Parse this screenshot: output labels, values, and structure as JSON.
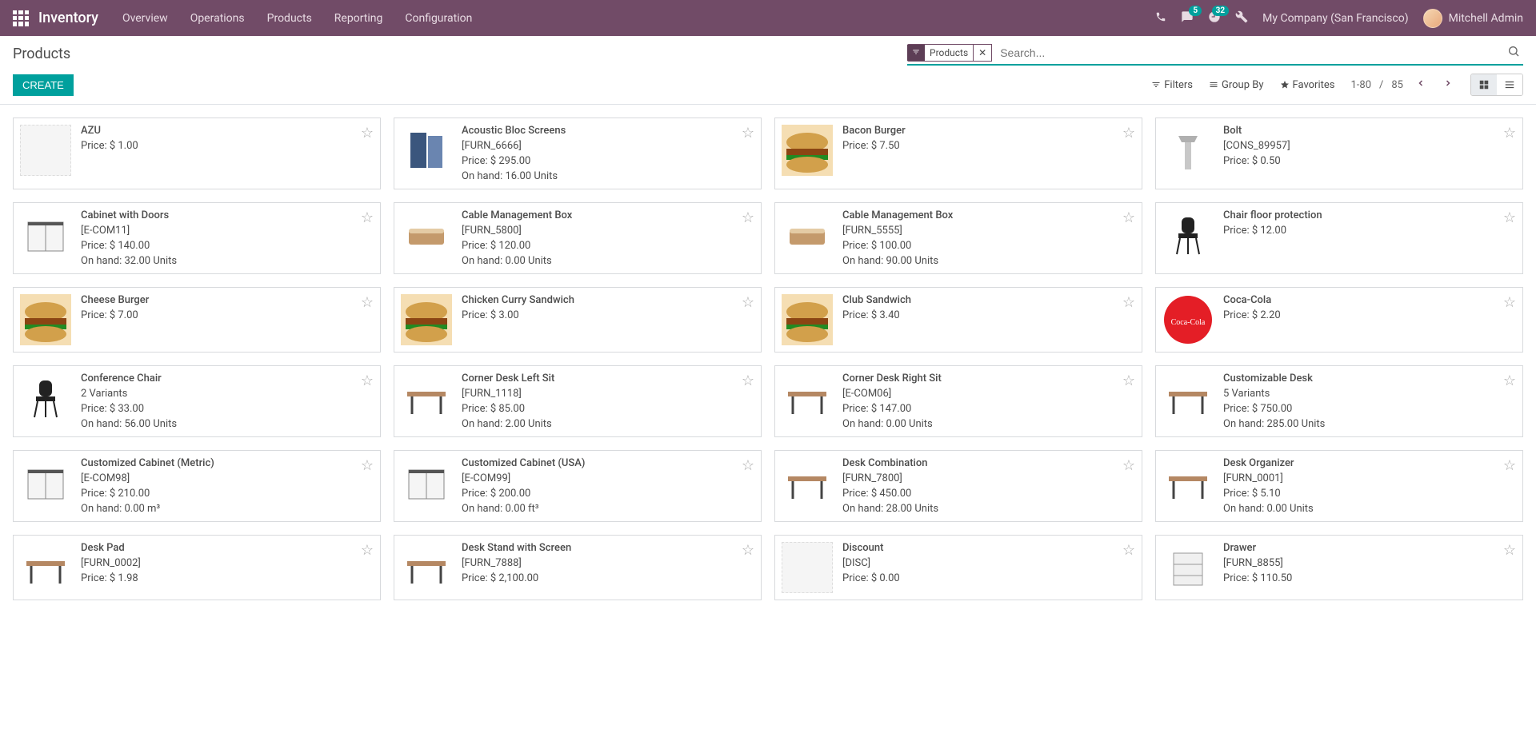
{
  "nav": {
    "appTitle": "Inventory",
    "menu": [
      "Overview",
      "Operations",
      "Products",
      "Reporting",
      "Configuration"
    ],
    "badges": {
      "messages": "5",
      "activities": "32"
    },
    "company": "My Company (San Francisco)",
    "user": "Mitchell Admin"
  },
  "control": {
    "breadcrumb": "Products",
    "createLabel": "CREATE",
    "filterTag": "Products",
    "searchPlaceholder": "Search...",
    "tools": {
      "filters": "Filters",
      "groupBy": "Group By",
      "favorites": "Favorites"
    },
    "pager": {
      "range": "1-80",
      "sep": "/",
      "total": "85"
    }
  },
  "products": [
    {
      "name": "AZU",
      "price": "Price: $ 1.00"
    },
    {
      "name": "Acoustic Bloc Screens",
      "sku": "[FURN_6666]",
      "price": "Price: $ 295.00",
      "onhand": "On hand: 16.00 Units"
    },
    {
      "name": "Bacon Burger",
      "price": "Price: $ 7.50"
    },
    {
      "name": "Bolt",
      "sku": "[CONS_89957]",
      "price": "Price: $ 0.50"
    },
    {
      "name": "Cabinet with Doors",
      "sku": "[E-COM11]",
      "price": "Price: $ 140.00",
      "onhand": "On hand: 32.00 Units"
    },
    {
      "name": "Cable Management Box",
      "sku": "[FURN_5800]",
      "price": "Price: $ 120.00",
      "onhand": "On hand: 0.00 Units"
    },
    {
      "name": "Cable Management Box",
      "sku": "[FURN_5555]",
      "price": "Price: $ 100.00",
      "onhand": "On hand: 90.00 Units"
    },
    {
      "name": "Chair floor protection",
      "price": "Price: $ 12.00"
    },
    {
      "name": "Cheese Burger",
      "price": "Price: $ 7.00"
    },
    {
      "name": "Chicken Curry Sandwich",
      "price": "Price: $ 3.00"
    },
    {
      "name": "Club Sandwich",
      "price": "Price: $ 3.40"
    },
    {
      "name": "Coca-Cola",
      "price": "Price: $ 2.20"
    },
    {
      "name": "Conference Chair",
      "variants": "2 Variants",
      "price": "Price: $ 33.00",
      "onhand": "On hand: 56.00 Units"
    },
    {
      "name": "Corner Desk Left Sit",
      "sku": "[FURN_1118]",
      "price": "Price: $ 85.00",
      "onhand": "On hand: 2.00 Units"
    },
    {
      "name": "Corner Desk Right Sit",
      "sku": "[E-COM06]",
      "price": "Price: $ 147.00",
      "onhand": "On hand: 0.00 Units"
    },
    {
      "name": "Customizable Desk",
      "variants": "5 Variants",
      "price": "Price: $ 750.00",
      "onhand": "On hand: 285.00 Units"
    },
    {
      "name": "Customized Cabinet (Metric)",
      "sku": "[E-COM98]",
      "price": "Price: $ 210.00",
      "onhand": "On hand: 0.00 m³"
    },
    {
      "name": "Customized Cabinet (USA)",
      "sku": "[E-COM99]",
      "price": "Price: $ 200.00",
      "onhand": "On hand: 0.00 ft³"
    },
    {
      "name": "Desk Combination",
      "sku": "[FURN_7800]",
      "price": "Price: $ 450.00",
      "onhand": "On hand: 28.00 Units"
    },
    {
      "name": "Desk Organizer",
      "sku": "[FURN_0001]",
      "price": "Price: $ 5.10",
      "onhand": "On hand: 0.00 Units"
    },
    {
      "name": "Desk Pad",
      "sku": "[FURN_0002]",
      "price": "Price: $ 1.98"
    },
    {
      "name": "Desk Stand with Screen",
      "sku": "[FURN_7888]",
      "price": "Price: $ 2,100.00"
    },
    {
      "name": "Discount",
      "sku": "[DISC]",
      "price": "Price: $ 0.00"
    },
    {
      "name": "Drawer",
      "sku": "[FURN_8855]",
      "price": "Price: $ 110.50"
    }
  ]
}
